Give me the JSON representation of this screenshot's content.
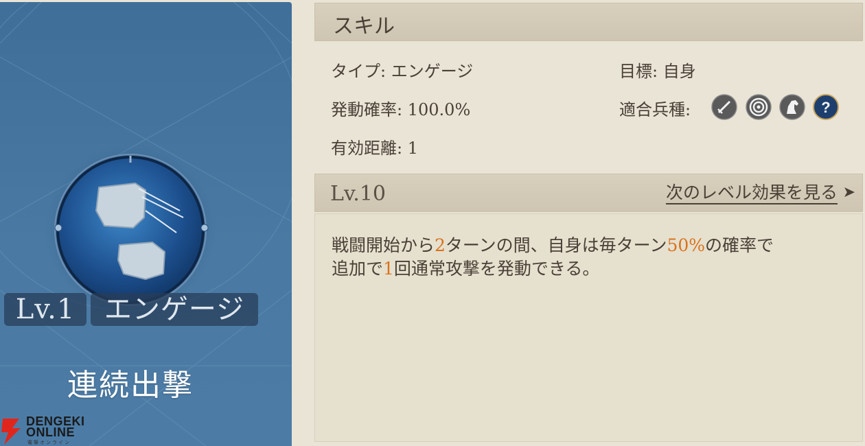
{
  "left": {
    "level": "Lv.1",
    "skill_type": "エンゲージ",
    "skill_name": "連続出撃",
    "watermark": {
      "line1": "DENGEKI",
      "line2": "ONLINE",
      "sub": "電撃オンライン"
    }
  },
  "skill": {
    "header": "スキル",
    "type_label": "タイプ:",
    "type_value": "エンゲージ",
    "target_label": "目標:",
    "target_value": "自身",
    "rate_label": "発動確率:",
    "rate_value": "100.0%",
    "units_label": "適合兵種:",
    "range_label": "有効距離:",
    "range_value": "1",
    "unit_icons": [
      "sword-icon",
      "target-icon",
      "horse-icon",
      "question-icon"
    ]
  },
  "level": {
    "title": "Lv.10",
    "next_link": "次のレベル効果を見る",
    "arrow": "➤"
  },
  "description": {
    "line1": [
      "戦闘開始から",
      "2",
      "ターンの間、自身は毎ターン",
      "50%",
      "の確率で"
    ],
    "line2": [
      "追加で",
      "1",
      "回通常攻撃を発動できる。"
    ]
  },
  "colors": {
    "highlight": "#d9731c",
    "card_blue": "#4a7aa3",
    "text": "#4a4036"
  }
}
